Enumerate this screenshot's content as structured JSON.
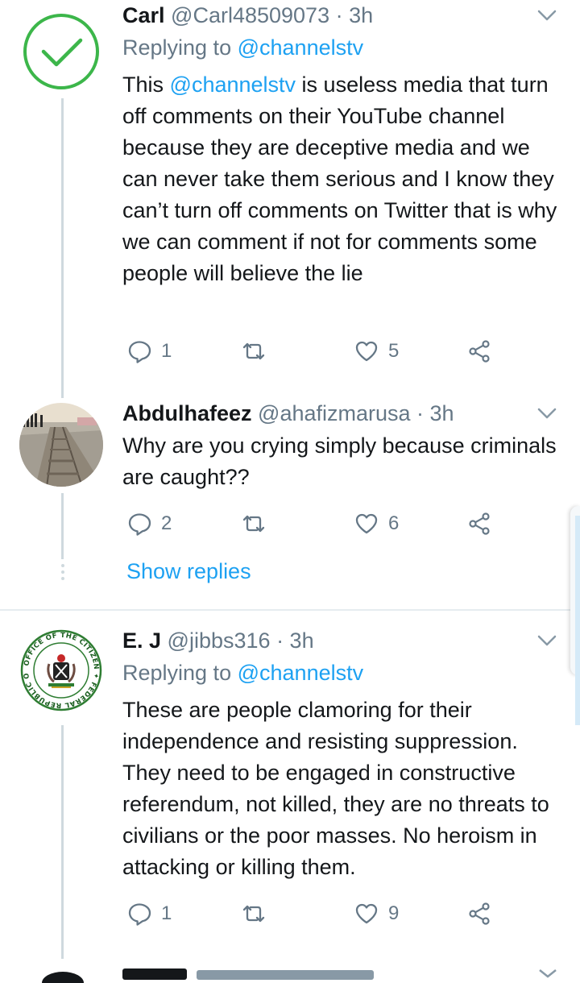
{
  "tweets": [
    {
      "name": "Carl",
      "handle": "@Carl48509073",
      "time": "· 3h",
      "replying_prefix": "Replying to",
      "replying_to": "@channelstv",
      "text_before": "This",
      "text_mention": "@channelstv",
      "text_after": "is useless media that turn off comments on their YouTube channel because they are deceptive media and we can never take them serious and I know they can’t turn off comments on Twitter that is why we can comment if not for comments some people will believe the lie",
      "replies": "1",
      "retweets": "",
      "likes": "5",
      "avatar_icon": "green-checkmark-icon"
    },
    {
      "name": "Abdulhafeez",
      "handle": "@ahafizmarusa",
      "time": "· 3h",
      "text": "Why are you crying simply because criminals are caught??",
      "replies": "2",
      "retweets": "",
      "likes": "6",
      "show_replies": "Show replies"
    },
    {
      "name": "E. J",
      "handle": "@jibbs316",
      "time": "· 3h",
      "replying_prefix": "Replying to",
      "replying_to": "@channelstv",
      "text": "These are people clamoring for their independence and resisting suppression. They need to be engaged in constructive referendum, not killed, they are no threats to civilians or the poor masses. No heroism in attacking or killing them.",
      "replies": "1",
      "retweets": "",
      "likes": "9"
    }
  ],
  "colors": {
    "accent": "#1da1f2",
    "muted": "#657786",
    "text": "#14171a",
    "line": "#cfd9de",
    "check_green": "#3cb64a"
  }
}
